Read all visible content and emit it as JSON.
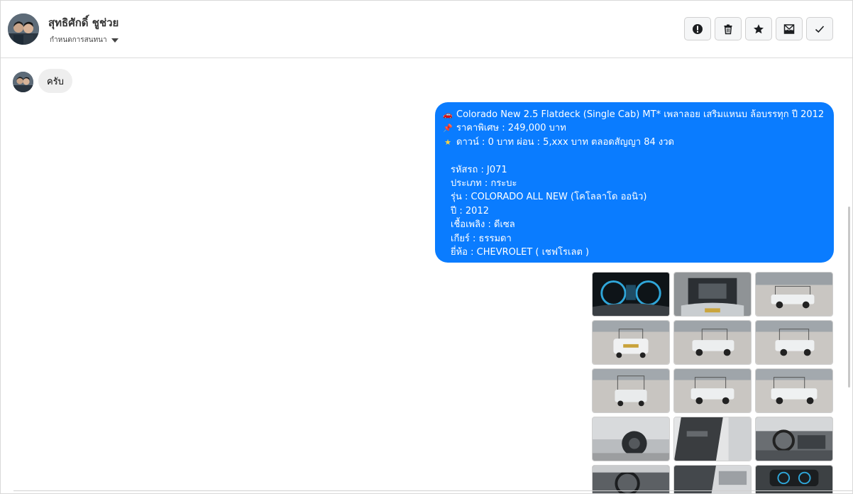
{
  "header": {
    "contact_name": "สุทธิศักดิ์ ชูช่วย",
    "assign_label": "กำหนดการสนทนา",
    "actions": [
      {
        "name": "report-button",
        "icon": "exclamation-icon"
      },
      {
        "name": "delete-button",
        "icon": "trash-icon"
      },
      {
        "name": "star-button",
        "icon": "star-icon"
      },
      {
        "name": "mark-unread-button",
        "icon": "envelope-icon"
      },
      {
        "name": "done-button",
        "icon": "check-icon"
      }
    ]
  },
  "messages": {
    "incoming_text": "ครับ",
    "outgoing": {
      "line1": "Colorado New 2.5 Flatdeck (Single Cab) MT* เพลาลอย เสริมแหนบ ล้อบรรทุก  ปี 2012",
      "line2": "ราคาพิเศษ : 249,000 บาท",
      "line3": "ดาวน์ : 0 บาท ผ่อน : 5,xxx บาท ตลอดสัญญา 84 งวด",
      "code": "รหัสรถ : J071",
      "type": "ประเภท : กระบะ",
      "model": "รุ่น : COLORADO ALL NEW (โคโลลาโด ออนิว)",
      "year": "ปี : 2012",
      "fuel": "เชื้อเพลิง : ดีเซล",
      "gear": "เกียร์ : ธรรมดา",
      "brand": "ยี่ห้อ : CHEVROLET ( เชฟโรเลต )"
    }
  },
  "colors": {
    "outgoing_bubble": "#0a7cff",
    "incoming_bubble": "#eeeeee",
    "action_bg": "#f5f6f7"
  }
}
